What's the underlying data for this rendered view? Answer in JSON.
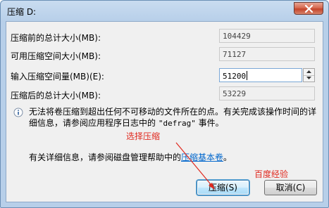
{
  "window": {
    "title": "压缩 D:",
    "close_icon": "close-icon"
  },
  "form": {
    "total_before_label": "压缩前的总计大小(MB):",
    "total_before_value": "104429",
    "available_label": "可用压缩空间大小(MB):",
    "available_value": "71127",
    "amount_label": "输入压缩空间量(MB)(E):",
    "amount_value": "51200",
    "total_after_label": "压缩后的总计大小(MB):",
    "total_after_value": "53229"
  },
  "info": {
    "icon": "info-icon",
    "text_part1": "无法将卷压缩到超出任何不可移动的文件所在的点。有关完成该操作时间的详细信息，请参阅应用程序日志中的",
    "quoted": "\"defrag\"",
    "text_part2": "事件。"
  },
  "more": {
    "prefix": "有关详细信息，请参阅磁盘管理帮助中的",
    "link": "压缩基本卷",
    "suffix": "。"
  },
  "annotations": {
    "select_compress": "选择压缩",
    "watermark": "百度经验",
    "color": "#e0291f"
  },
  "buttons": {
    "compress": "压缩(S)",
    "cancel": "取消(C)"
  }
}
